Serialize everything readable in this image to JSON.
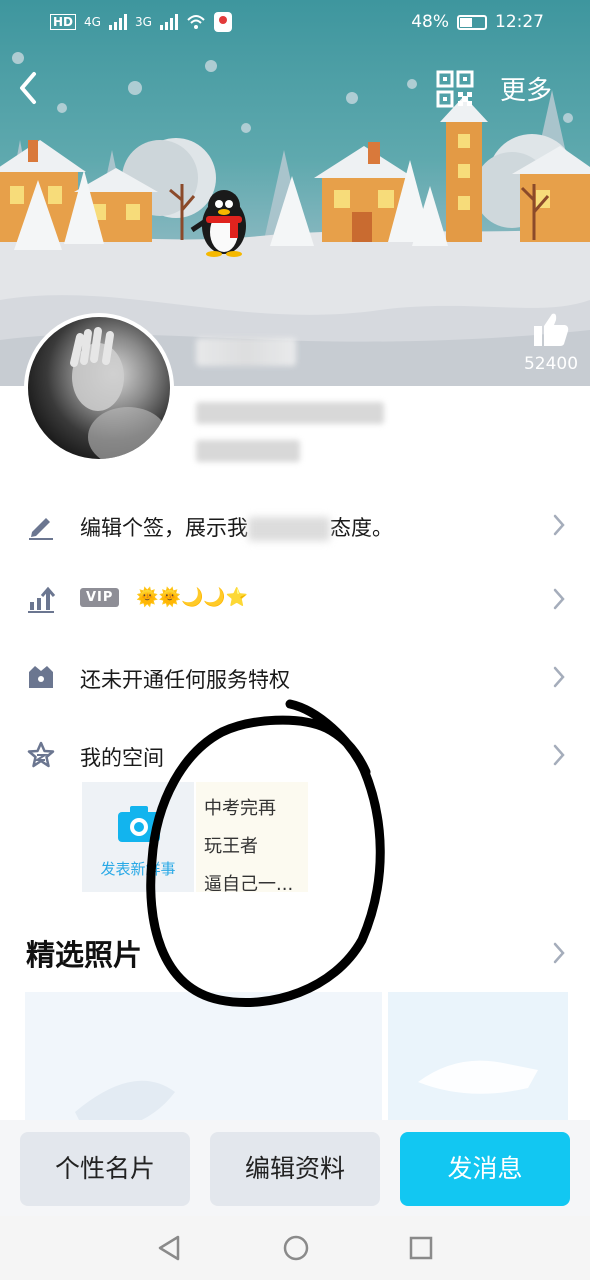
{
  "status_bar": {
    "left_badges": [
      "HD",
      "4G",
      "3G"
    ],
    "battery_percent": "48%",
    "time": "12:27"
  },
  "header": {
    "more_label": "更多"
  },
  "profile": {
    "like_count": "52400"
  },
  "rows": {
    "signature": {
      "prefix": "编辑个签，展示我",
      "suffix": "态度。"
    },
    "vip": {
      "tag": "VIP",
      "icons": "🌞🌞🌙🌙⭐"
    },
    "service": {
      "label": "还未开通任何服务特权"
    },
    "space": {
      "label": "我的空间"
    }
  },
  "space_card": {
    "post_button": "发表新鲜事",
    "post_lines": [
      "中考完再",
      "玩王者",
      "逼自己一..."
    ]
  },
  "featured_photos": {
    "title": "精选照片"
  },
  "actions": {
    "profile_card": "个性名片",
    "edit_profile": "编辑资料",
    "send_message": "发消息"
  },
  "colors": {
    "accent_blue": "#12c7f2",
    "camera_blue": "#2aa9e6",
    "icon_gray": "#6b7690"
  }
}
